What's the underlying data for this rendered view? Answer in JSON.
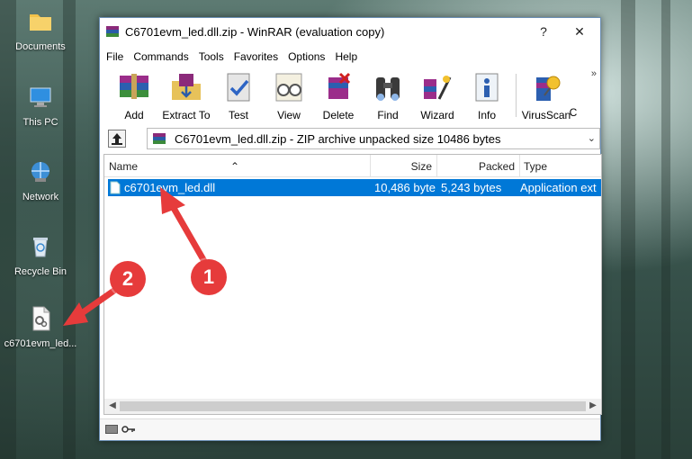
{
  "desktop": {
    "icons": [
      {
        "label": "Documents"
      },
      {
        "label": "This PC"
      },
      {
        "label": "Network"
      },
      {
        "label": "Recycle Bin"
      },
      {
        "label": "c6701evm_led..."
      }
    ]
  },
  "window": {
    "title": "C6701evm_led.dll.zip - WinRAR (evaluation copy)",
    "help_button": "?",
    "close_button": "✕",
    "menu": [
      "File",
      "Commands",
      "Tools",
      "Favorites",
      "Options",
      "Help"
    ],
    "toolbar": [
      {
        "label": "Add",
        "icon": "books-icon"
      },
      {
        "label": "Extract To",
        "icon": "extract-folder-icon"
      },
      {
        "label": "Test",
        "icon": "test-check-icon"
      },
      {
        "label": "View",
        "icon": "glasses-icon"
      },
      {
        "label": "Delete",
        "icon": "delete-icon"
      },
      {
        "label": "Find",
        "icon": "binoculars-icon"
      },
      {
        "label": "Wizard",
        "icon": "wizard-icon"
      },
      {
        "label": "Info",
        "icon": "info-icon"
      },
      {
        "label": "VirusScan",
        "icon": "virusscan-icon"
      },
      {
        "label": "C",
        "icon": ""
      }
    ],
    "toolbar_more": "»",
    "address": "C6701evm_led.dll.zip - ZIP archive unpacked size 10486 bytes",
    "columns": [
      "Name",
      "Size",
      "Packed",
      "Type"
    ],
    "files": [
      {
        "name": "c6701evm_led.dll",
        "size": "10,486 byte",
        "packed": "5,243 bytes",
        "type": "Application ext"
      }
    ]
  },
  "annotations": {
    "badge1": "1",
    "badge2": "2"
  },
  "colors": {
    "selection": "#0078d7",
    "badge": "#e63b3b"
  }
}
